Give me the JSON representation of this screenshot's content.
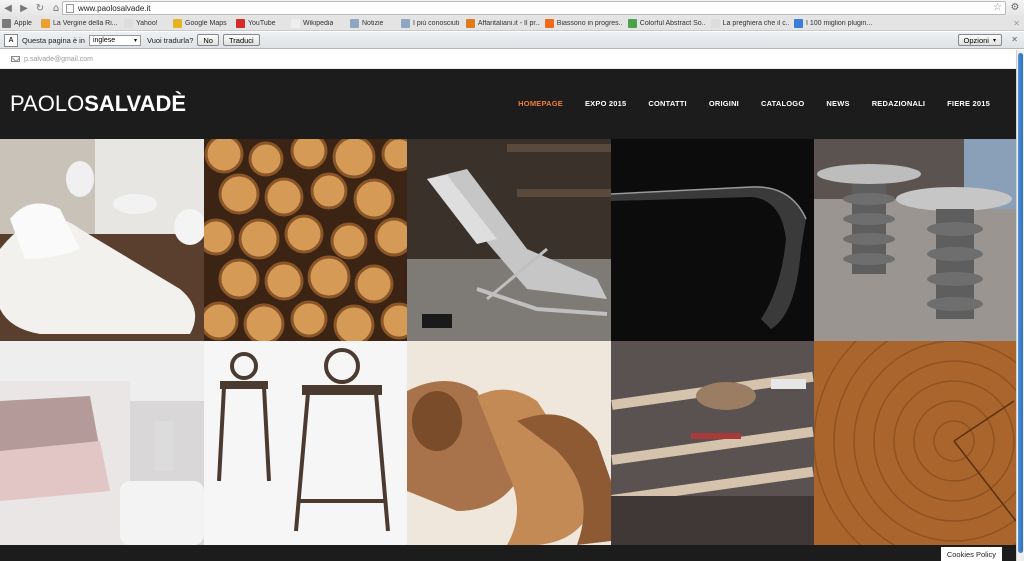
{
  "browser": {
    "url": "www.paolosalvade.it",
    "bookmarks": [
      {
        "label": "Apple",
        "icon": "apple-icon",
        "color": "#7a7a7a"
      },
      {
        "label": "La Vergine della Ri...",
        "icon": "site-icon",
        "color": "#e8a030"
      },
      {
        "label": "Yahoo!",
        "icon": "page-icon",
        "color": "#dddddd"
      },
      {
        "label": "Google Maps",
        "icon": "maps-icon",
        "color": "#e6b422"
      },
      {
        "label": "YouTube",
        "icon": "youtube-icon",
        "color": "#d62b2b"
      },
      {
        "label": "Wikipedia",
        "icon": "wikipedia-icon",
        "color": "#eeeeee"
      },
      {
        "label": "Notizie",
        "icon": "folder-icon",
        "color": "#8fa6c0"
      },
      {
        "label": "I più conosciuti",
        "icon": "folder-icon",
        "color": "#8fa6c0"
      },
      {
        "label": "Affaritaliani.it - Il pr...",
        "icon": "site-icon",
        "color": "#e07a1a"
      },
      {
        "label": "Biassono in progres...",
        "icon": "blogger-icon",
        "color": "#f06a1c"
      },
      {
        "label": "Colorful Abstract So...",
        "icon": "leaf-icon",
        "color": "#4aa24a"
      },
      {
        "label": "La preghiera che il c...",
        "icon": "page-icon",
        "color": "#dddddd"
      },
      {
        "label": "I 100 migliori plugin...",
        "icon": "check-icon",
        "color": "#3b7dd8"
      }
    ],
    "translate": {
      "prompt": "Questa pagina è in",
      "language": "inglese",
      "question": "Vuoi tradurla?",
      "no_label": "No",
      "translate_label": "Traduci",
      "options_label": "Opzioni"
    }
  },
  "site": {
    "email": "p.salvade@gmail.com",
    "logo_light": "PAOLO",
    "logo_bold": "SALVADÈ",
    "nav": [
      {
        "label": "HOMEPAGE",
        "active": true
      },
      {
        "label": "EXPO 2015",
        "active": false
      },
      {
        "label": "CONTATTI",
        "active": false
      },
      {
        "label": "ORIGINI",
        "active": false
      },
      {
        "label": "CATALOGO",
        "active": false
      },
      {
        "label": "NEWS",
        "active": false
      },
      {
        "label": "REDAZIONALI",
        "active": false
      },
      {
        "label": "FIERE 2015",
        "active": false
      }
    ],
    "accent_color": "#ef7d3a",
    "cookies_label": "Cookies Policy"
  }
}
